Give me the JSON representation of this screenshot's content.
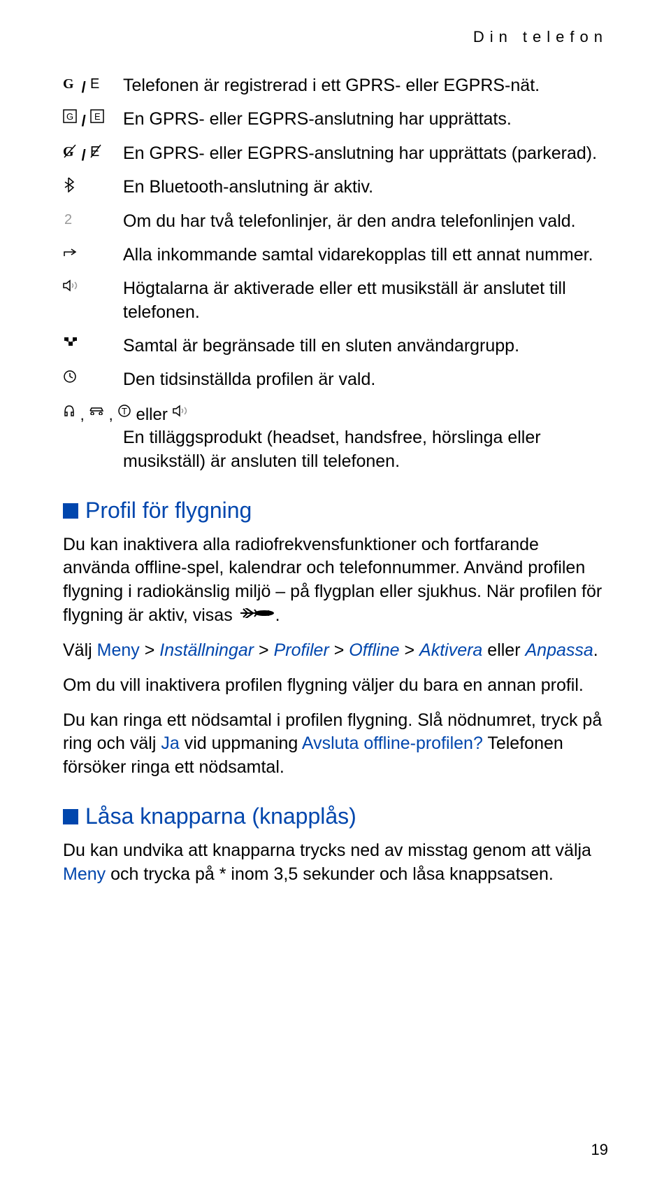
{
  "header": "Din telefon",
  "rows": [
    {
      "icon_left": "G",
      "icon_right": "E",
      "text": "Telefonen är registrerad i ett GPRS- eller EGPRS-nät."
    },
    {
      "icon_left": "G-box",
      "icon_right": "E-box",
      "text": "En GPRS- eller EGPRS-anslutning har upprättats."
    },
    {
      "icon_left": "G-slash",
      "icon_right": "E-slash",
      "text": "En GPRS- eller EGPRS-anslutning har upprättats (parkerad)."
    },
    {
      "icon": "bluetooth",
      "text": "En Bluetooth-anslutning är aktiv."
    },
    {
      "icon": "two",
      "text": "Om du har två telefonlinjer, är den andra telefonlinjen vald."
    },
    {
      "icon": "forward",
      "text": "Alla inkommande samtal vidarekopplas till ett annat nummer."
    },
    {
      "icon": "speaker",
      "text": "Högtalarna är aktiverade eller ett musikställ är anslutet till telefonen."
    },
    {
      "icon": "group",
      "text": "Samtal är begränsade till en sluten användargrupp."
    },
    {
      "icon": "clock",
      "text": "Den tidsinställda profilen är vald."
    }
  ],
  "accessory_row": {
    "connector": " eller ",
    "text": "En tilläggsprodukt (headset, handsfree, hörslinga eller musikställ) är ansluten till telefonen."
  },
  "section1": {
    "title": "Profil för flygning",
    "p1a": "Du kan inaktivera alla radiofrekvensfunktioner och fortfarande använda offline-spel, kalendrar och telefonnummer. Använd profilen flygning i radiokänslig miljö – på flygplan eller sjukhus. När profilen för flygning är aktiv, visas ",
    "p1b": ".",
    "p2_pre": "Välj ",
    "p2_menu": "Meny",
    "p2_gt1": " > ",
    "p2_inst": "Inställningar",
    "p2_gt2": " > ",
    "p2_prof": "Profiler",
    "p2_gt3": " > ",
    "p2_off": "Offline ",
    "p2_gt4": " > ",
    "p2_akt": "Aktivera",
    "p2_eller": " eller ",
    "p2_anp": "Anpassa",
    "p2_dot": ".",
    "p3": "Om du vill inaktivera profilen flygning väljer du bara en annan profil.",
    "p4a": "Du kan ringa ett nödsamtal i profilen flygning. Slå nödnumret, tryck på ring och välj ",
    "p4_ja": "Ja",
    "p4b": " vid uppmaning ",
    "p4_q": "Avsluta offline-profilen?",
    "p4c": " Telefonen försöker ringa ett nödsamtal."
  },
  "section2": {
    "title": "Låsa knapparna (knapplås)",
    "p1a": "Du kan undvika att knapparna trycks ned av misstag genom att välja ",
    "p1_menu": "Meny",
    "p1b": " och trycka på * inom 3,5 sekunder och låsa knappsatsen."
  },
  "page_number": "19"
}
